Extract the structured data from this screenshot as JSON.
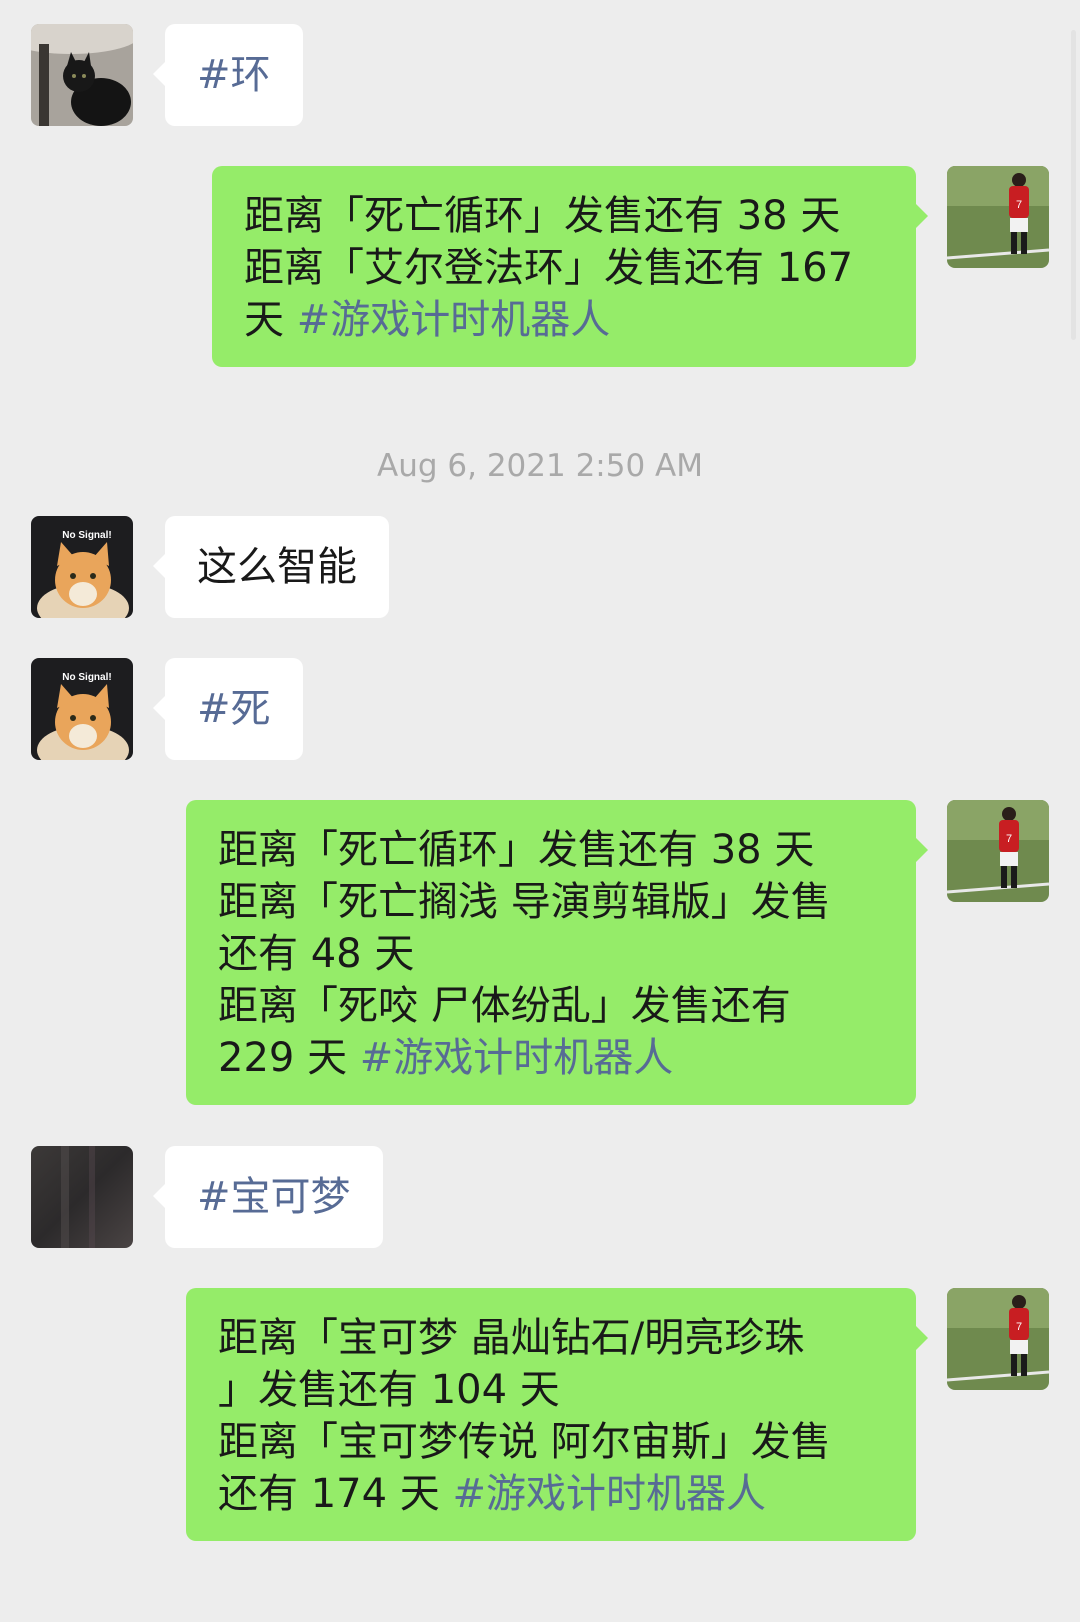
{
  "timestamp": "Aug 6, 2021 2:50 AM",
  "messages": [
    {
      "sender": "other",
      "avatar": "black-cat-avatar",
      "text": "#环"
    },
    {
      "sender": "self",
      "avatar": "soccer-player-avatar",
      "lines": [
        "距离「死亡循环」发售还有 38 天",
        "距离「艾尔登法环」发售还有 167",
        "天 "
      ],
      "hashtag": "#游戏计时机器人"
    },
    {
      "sender": "other",
      "avatar": "no-signal-cat-avatar",
      "text": "这么智能"
    },
    {
      "sender": "other",
      "avatar": "no-signal-cat-avatar",
      "text": "#死"
    },
    {
      "sender": "self",
      "avatar": "soccer-player-avatar",
      "lines": [
        "距离「死亡循环」发售还有 38 天",
        "距离「死亡搁浅 导演剪辑版」发售",
        "还有 48 天",
        "距离「死咬 尸体纷乱」发售还有",
        "229 天 "
      ],
      "hashtag": "#游戏计时机器人"
    },
    {
      "sender": "other",
      "avatar": "dark-blurred-avatar",
      "text": "#宝可梦"
    },
    {
      "sender": "self",
      "avatar": "soccer-player-avatar",
      "lines": [
        "距离「宝可梦 晶灿钻石/明亮珍珠",
        "」发售还有 104 天",
        "距离「宝可梦传说 阿尔宙斯」发售",
        "还有 174 天 "
      ],
      "hashtag": "#游戏计时机器人"
    }
  ],
  "colors": {
    "background": "#ededed",
    "self_bubble": "#95ec69",
    "other_bubble": "#ffffff",
    "hashtag": "#576b95",
    "timestamp": "#a9a9a9"
  }
}
